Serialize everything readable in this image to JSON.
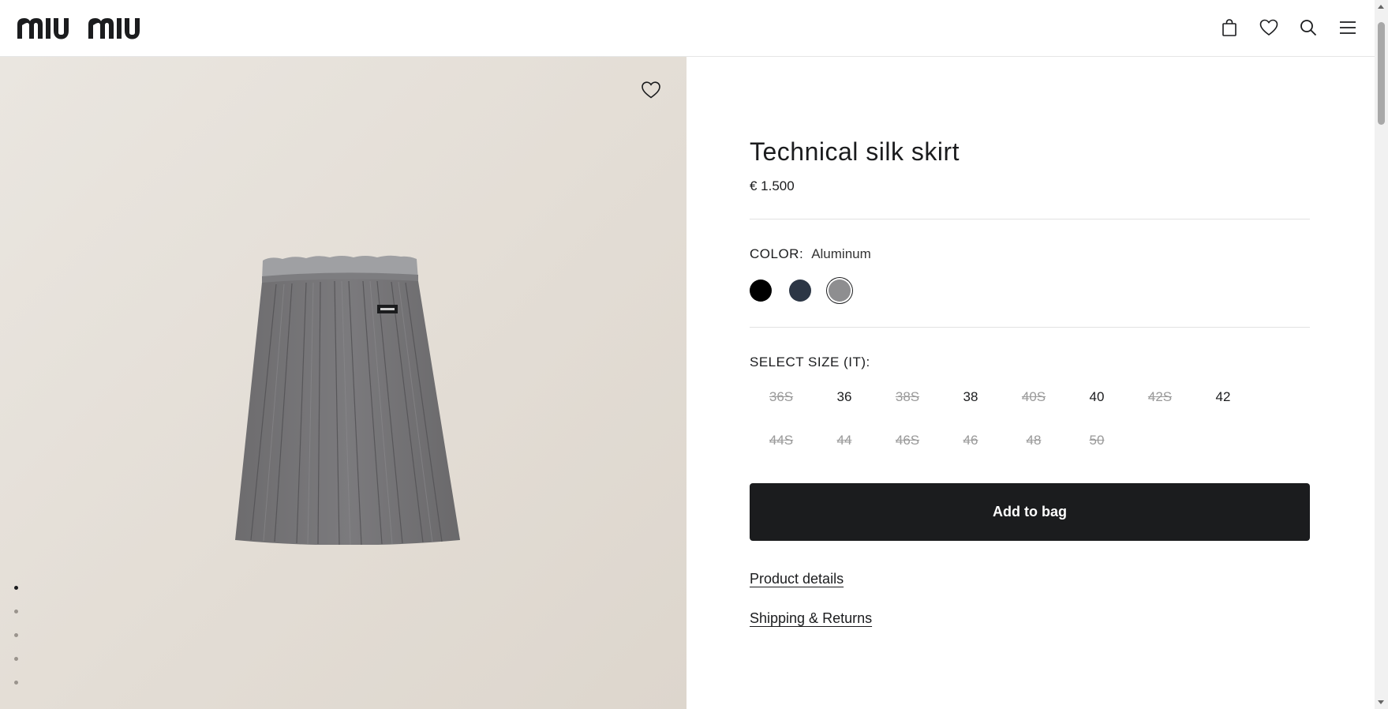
{
  "header": {
    "logo_alt": "miu miu",
    "icons": [
      "shopping-bag-icon",
      "heart-icon",
      "search-icon",
      "menu-icon"
    ]
  },
  "gallery": {
    "background": "#e5e0d9",
    "image_alt": "Technical silk skirt",
    "dots_count": 5,
    "active_dot": 0
  },
  "product": {
    "title": "Technical silk skirt",
    "price": "€ 1.500",
    "color_label": "COLOR:",
    "color_value": "Aluminum",
    "swatches": [
      {
        "name": "Black",
        "color": "#000000"
      },
      {
        "name": "Navy",
        "color": "#2c3645"
      },
      {
        "name": "Aluminum",
        "color": "#8e8e90",
        "selected": true
      }
    ],
    "size_label": "SELECT SIZE (IT):",
    "sizes": [
      {
        "label": "36S",
        "available": false
      },
      {
        "label": "36",
        "available": true
      },
      {
        "label": "38S",
        "available": false
      },
      {
        "label": "38",
        "available": true
      },
      {
        "label": "40S",
        "available": false
      },
      {
        "label": "40",
        "available": true
      },
      {
        "label": "42S",
        "available": false
      },
      {
        "label": "42",
        "available": true
      },
      {
        "label": "44S",
        "available": false
      },
      {
        "label": "44",
        "available": false
      },
      {
        "label": "46S",
        "available": false
      },
      {
        "label": "46",
        "available": false
      },
      {
        "label": "48",
        "available": false
      },
      {
        "label": "50",
        "available": false
      }
    ],
    "add_to_bag": "Add to bag",
    "links": {
      "details": "Product details",
      "shipping": "Shipping & Returns"
    }
  },
  "colors": {
    "primary": "#1b1c1e",
    "disabled": "#9a9a9a"
  }
}
